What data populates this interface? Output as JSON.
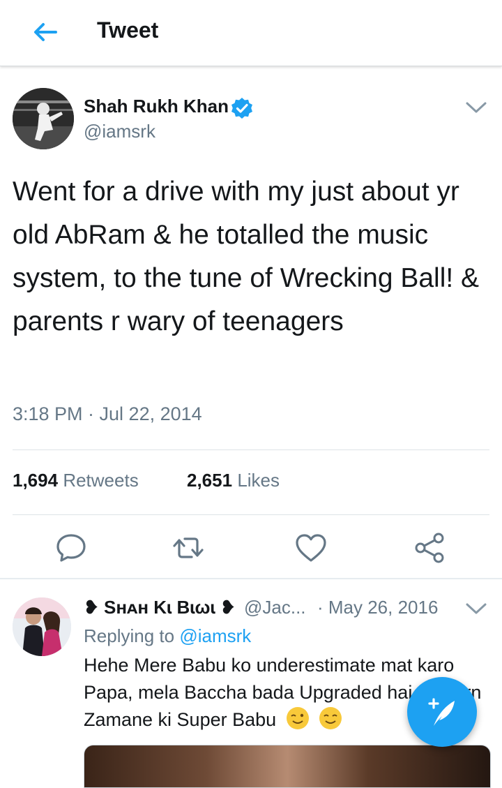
{
  "header": {
    "title": "Tweet",
    "back_icon": "arrow-left-icon"
  },
  "tweet": {
    "author_name": "Shah Rukh Khan",
    "author_handle": "@iamsrk",
    "verified": true,
    "text": "Went for a drive with my just about yr old AbRam & he totalled the music system, to the tune of Wrecking Ball! & parents r wary of teenagers",
    "timestamp": "3:18 PM · Jul 22, 2014",
    "retweets_count": "1,694",
    "retweets_label": "Retweets",
    "likes_count": "2,651",
    "likes_label": "Likes",
    "actions": [
      "reply-icon",
      "retweet-icon",
      "like-icon",
      "share-icon"
    ]
  },
  "reply": {
    "author_name": "❥ Sʜᴀʜ Kɩ Bɩωɩ ❥",
    "author_handle": "@Jac...",
    "date": "· May 26, 2016",
    "replying_prefix": "Replying to",
    "replying_to": "@iamsrk",
    "text": "Hehe Mere Babu ko underestimate mat karo Papa, mela Baccha bada Upgraded hai modern Zamane ki Super Babu"
  },
  "fab": {
    "icon": "compose-tweet-icon"
  },
  "colors": {
    "accent": "#1da1f2",
    "verified": "#1da1f2",
    "text": "#14171a",
    "secondary_text": "#657786"
  }
}
